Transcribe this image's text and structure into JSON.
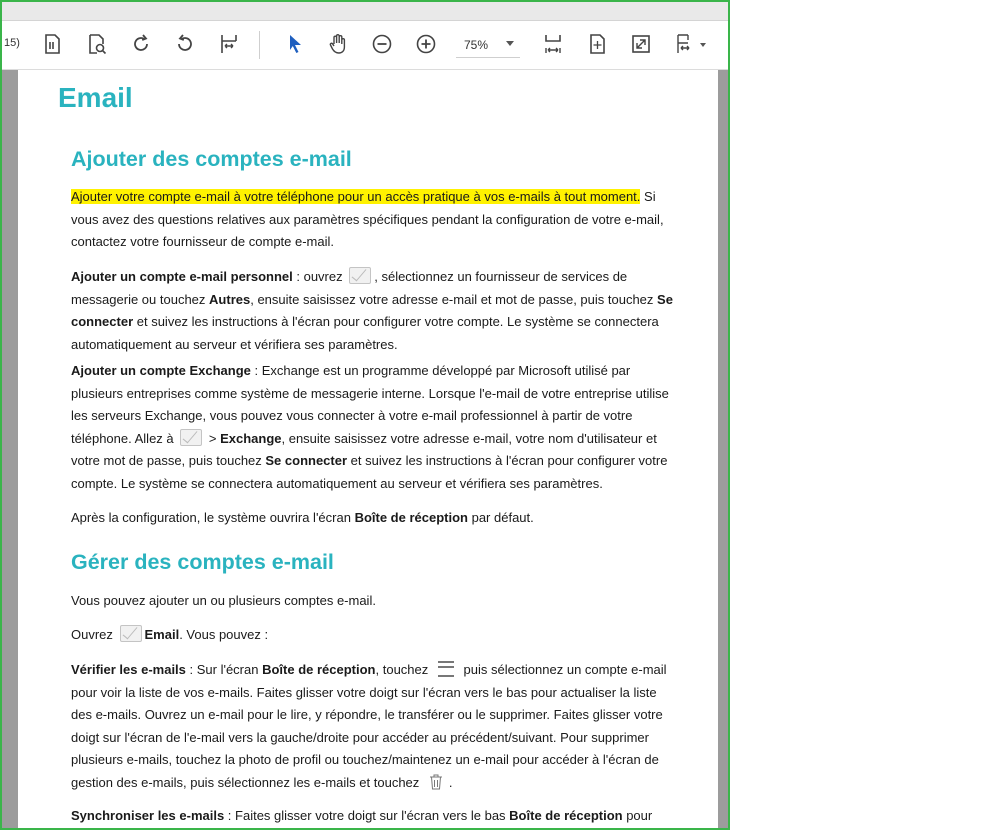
{
  "toolbar": {
    "page_count": "15)",
    "zoom": "75%",
    "icons": [
      "page-number-icon",
      "find-page-icon",
      "rotate-clockwise-icon",
      "rotate-counterclockwise-icon",
      "fit-width-icon",
      "select-cursor-icon",
      "hand-tool-icon",
      "zoom-out-icon",
      "zoom-in-icon",
      "fit-page-width-icon",
      "fit-page-icon",
      "fullscreen-icon",
      "page-layout-icon"
    ],
    "accent": "#1f5fbf"
  },
  "doc": {
    "title": "Email",
    "sec1": {
      "heading": "Ajouter des comptes e-mail",
      "p1_highlight": "Ajouter votre compte e-mail à votre téléphone pour un accès pratique à vos e-mails à tout moment.",
      "p1_rest": " Si vous avez des questions relatives aux paramètres spécifiques pendant la configuration de votre e-mail, contactez votre fournisseur de compte e-mail.",
      "p2_bold": "Ajouter un compte e-mail personnel",
      "p2_a": " : ouvrez ",
      "p2_b": ", sélectionnez un fournisseur de services de messagerie ou touchez ",
      "p2_autres": "Autres",
      "p2_c": ", ensuite saisissez votre adresse e-mail et mot de passe, puis touchez ",
      "p2_seconnecter": "Se connecter",
      "p2_d": " et suivez les instructions à l'écran pour configurer votre compte. Le système se connectera automatiquement au serveur et vérifiera ses paramètres.",
      "p3_bold": "Ajouter un compte Exchange",
      "p3_a": " : Exchange est un programme développé par Microsoft utilisé par plusieurs entreprises comme système de messagerie interne. Lorsque l'e-mail de votre entreprise utilise les serveurs Exchange, vous pouvez vous connecter à votre e-mail professionnel à partir de votre téléphone. Allez à ",
      "p3_b": " > ",
      "p3_exchange": "Exchange",
      "p3_c": ", ensuite saisissez votre adresse e-mail, votre nom d'utilisateur et votre mot de passe, puis touchez ",
      "p3_seconnecter": "Se connecter",
      "p3_d": " et suivez les instructions à l'écran pour configurer votre compte. Le système se connectera automatiquement au serveur et vérifiera ses paramètres.",
      "p4_a": "Après la configuration, le système ouvrira l'écran ",
      "p4_bold": "Boîte de réception",
      "p4_b": " par défaut."
    },
    "sec2": {
      "heading": "Gérer des comptes e-mail",
      "p1": "Vous pouvez ajouter un ou plusieurs comptes e-mail.",
      "p2_a": "Ouvrez ",
      "p2_bold": "Email",
      "p2_b": ". Vous pouvez :",
      "p3_bold": "Vérifier les e-mails",
      "p3_a": " : Sur l'écran ",
      "p3_boite": "Boîte de réception",
      "p3_b": ", touchez ",
      "p3_c": " puis sélectionnez un compte e-mail pour voir la liste de vos e-mails. Faites glisser votre doigt sur l'écran vers le bas pour actualiser la liste des e-mails. Ouvrez un e-mail pour le lire, y répondre, le transférer ou le supprimer. Faites glisser votre doigt sur l'écran de l'e-mail vers la gauche/droite pour accéder au précédent/suivant. Pour supprimer plusieurs e-mails, touchez la photo de profil ou touchez/maintenez un e-mail pour accéder à l'écran de gestion des e-mails, puis sélectionnez les e-mails et touchez ",
      "p3_d": ".",
      "p4_bold": "Synchroniser les e-mails",
      "p4_a": " : Faites glisser votre doigt sur l'écran vers le bas ",
      "p4_boite": "Boîte de réception",
      "p4_b": " pour"
    }
  }
}
